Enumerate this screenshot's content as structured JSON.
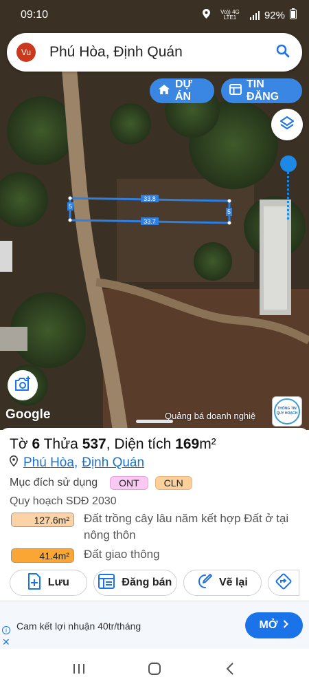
{
  "status_bar": {
    "time": "09:10",
    "network": "Vo)) 4G LTE1",
    "battery": "92%"
  },
  "search": {
    "avatar": "Vu",
    "query": "Phú Hòa, Định Quán",
    "icon": "search-icon"
  },
  "map": {
    "pills": [
      {
        "label": "DỰ ÁN",
        "icon": "home-icon"
      },
      {
        "label": "TIN ĐĂNG",
        "icon": "listing-icon"
      }
    ],
    "parcel_lengths": {
      "top": "33.8",
      "bottom": "33.7",
      "left": "5",
      "right": "5"
    },
    "google": "Google",
    "ad_text": "Quảng bá doanh nghiệ",
    "badge_line1": "THÔNG TIN",
    "badge_line2": "QUY HOẠCH"
  },
  "parcel": {
    "to_label": "Tờ",
    "to_value": "6",
    "thua_label": "Thửa",
    "thua_value": "537",
    "area_label": ", Diện tích",
    "area_value": "169",
    "area_unit": "m²",
    "ward": "Phú Hòa",
    "separator": ",",
    "district": "Định Quán",
    "purpose_label": "Mục đích sử dụng",
    "purpose_badges": [
      "ONT",
      "CLN"
    ],
    "plan_label": "Quy hoạch SDĐ 2030",
    "zones": [
      {
        "area": "127.6m²",
        "desc": "Đất trồng cây lâu năm kết hợp Đất ở tại nông thôn",
        "color": "#fcd3a6"
      },
      {
        "area": "41.4m²",
        "desc": "Đất giao thông",
        "color": "#f9a635"
      }
    ]
  },
  "actions": {
    "save": "Lưu",
    "sell": "Đăng bán",
    "redraw": "Vẽ lại"
  },
  "ad": {
    "text": "Cam kết lợi nhuận 40tr/tháng",
    "button": "MỞ",
    "info": "i",
    "close": "✕"
  }
}
